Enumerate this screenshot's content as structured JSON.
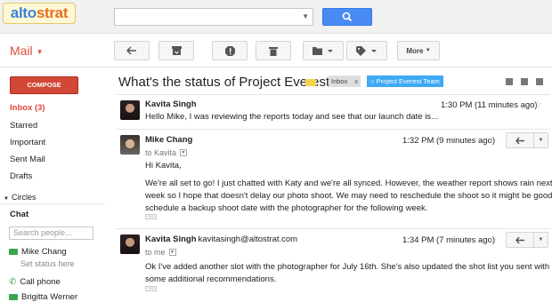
{
  "header": {
    "logo_part1": "alto",
    "logo_part2": "strat",
    "search": {
      "placeholder": ""
    }
  },
  "toolbar": {
    "mail_label": "Mail",
    "more_label": "More"
  },
  "sidebar": {
    "compose_label": "COMPOSE",
    "items": [
      {
        "label": "Inbox (3)"
      },
      {
        "label": "Starred"
      },
      {
        "label": "Important"
      },
      {
        "label": "Sent Mail"
      },
      {
        "label": "Drafts"
      }
    ],
    "circles_label": "Circles",
    "chat": {
      "title": "Chat",
      "search_placeholder": "Search people...",
      "self_name": "Mike Chang",
      "status_text": "Set status here",
      "call_phone": "Call phone",
      "contact": "Brigitta Werner"
    }
  },
  "thread": {
    "subject": "What's the status of Project Everest?",
    "labels": {
      "inbox": "Inbox",
      "inbox_close": "x",
      "team": "Project Everest Team"
    },
    "messages": [
      {
        "sender": "Kavita Singh",
        "snippet": "Hello Mike, I was reviewing the reports today and see that our launch date is...",
        "time": "1:30 PM (11 minutes ago)"
      },
      {
        "sender": "Mike Chang",
        "to": "to Kavita",
        "time": "1:32 PM (9 minutes ago)",
        "body": [
          "Hi Kavita,",
          "We're all set to go! I just chatted with Katy and we're all synced. However, the weather report shows rain next",
          "week so I hope that doesn't delay our photo shoot. We may need to reschedule the shoot so it might be good to",
          "schedule a backup shoot date with the photographer for the following week."
        ],
        "dots": "..."
      },
      {
        "sender": "Kavita Singh",
        "sender_email": "kavitasingh@altostrat.com",
        "to": "to me",
        "time": "1:34 PM (7 minutes ago)",
        "body": [
          "Ok I've added another slot with the photographer for July 16th. She's also updated the shot list you sent with",
          "some additional recommendations."
        ],
        "dots": "..."
      }
    ]
  },
  "colors": {
    "accent_red": "#dd4b39",
    "compose_red": "#d14836",
    "search_blue": "#4a8af4",
    "team_label": "#3fa9f5",
    "online_green": "#3aa64e"
  },
  "icons": [
    "search-icon",
    "reply-icon",
    "archive-icon",
    "spam-icon",
    "trash-icon",
    "folder-icon",
    "label-icon",
    "star-icon",
    "print-icon",
    "new-window-icon",
    "video-icon",
    "phone-icon"
  ]
}
